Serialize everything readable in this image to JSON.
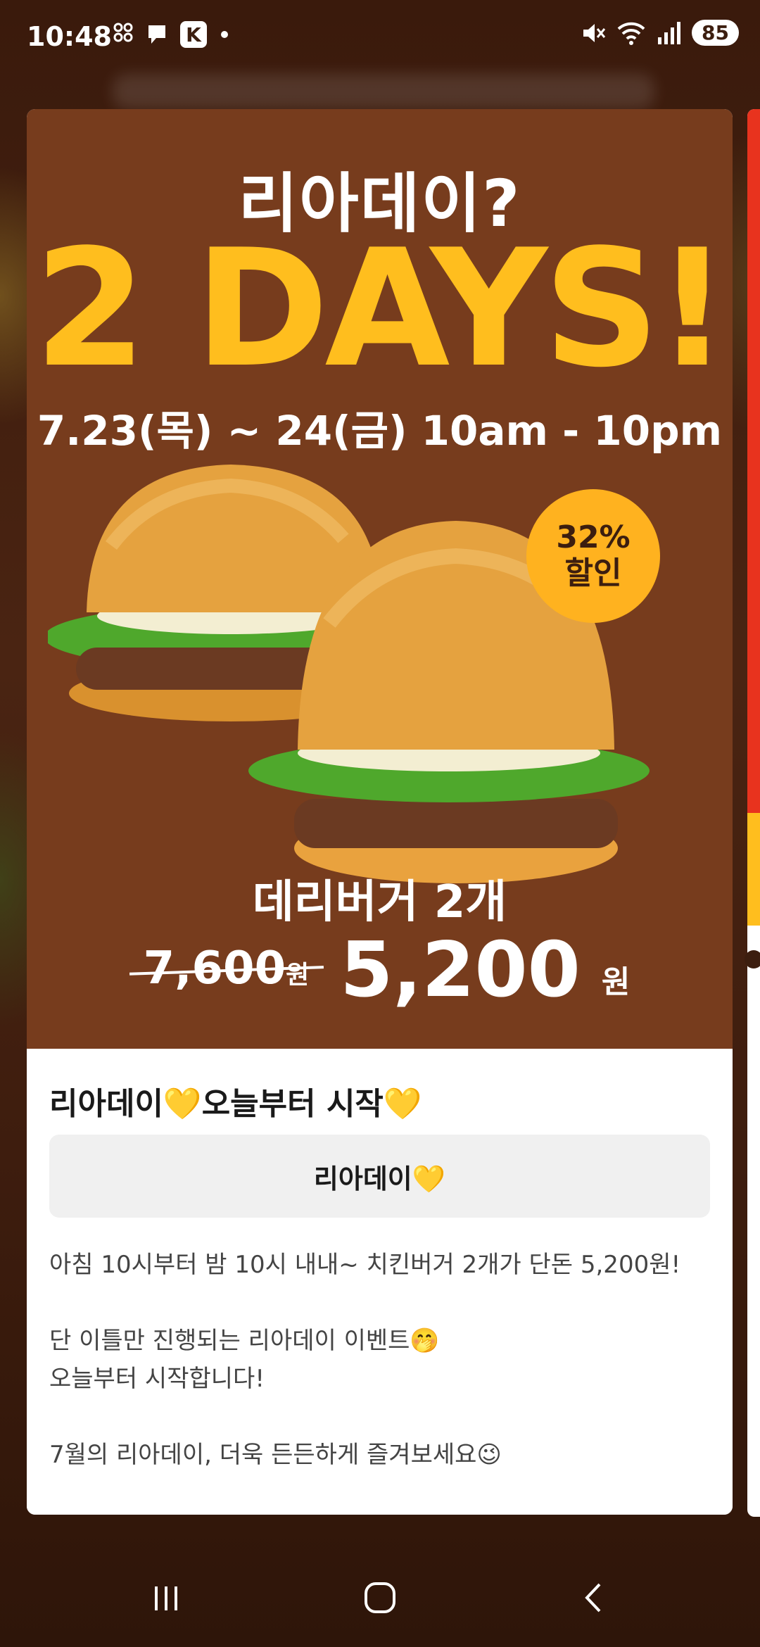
{
  "status_bar": {
    "time": "10:48",
    "k_label": "K",
    "battery": "85"
  },
  "banner": {
    "headline": "리아데이?",
    "days": "2 DAYS!",
    "date": "7.23(목) ~ 24(금) 10am - 10pm",
    "badge_line1": "32%",
    "badge_line2": "할인",
    "product": "데리버거 2개",
    "old_price": "7,600",
    "old_won": "원",
    "new_price": "5,200",
    "new_won": "원"
  },
  "post": {
    "title": "리아데이💛오늘부터 시작💛",
    "tag_button": "리아데이💛",
    "lines": [
      "아침 10시부터 밤 10시 내내~ 치킨버거 2개가 단돈 5,200원!",
      "단 이틀만 진행되는 리아데이 이벤트🤭",
      "오늘부터 시작합니다!",
      "7월의 리아데이, 더욱 든든하게 즐겨보세요😉"
    ]
  },
  "colors": {
    "banner_bg": "#773c1d",
    "accent_yellow": "#ffbe1e",
    "badge": "#ffb21f"
  }
}
